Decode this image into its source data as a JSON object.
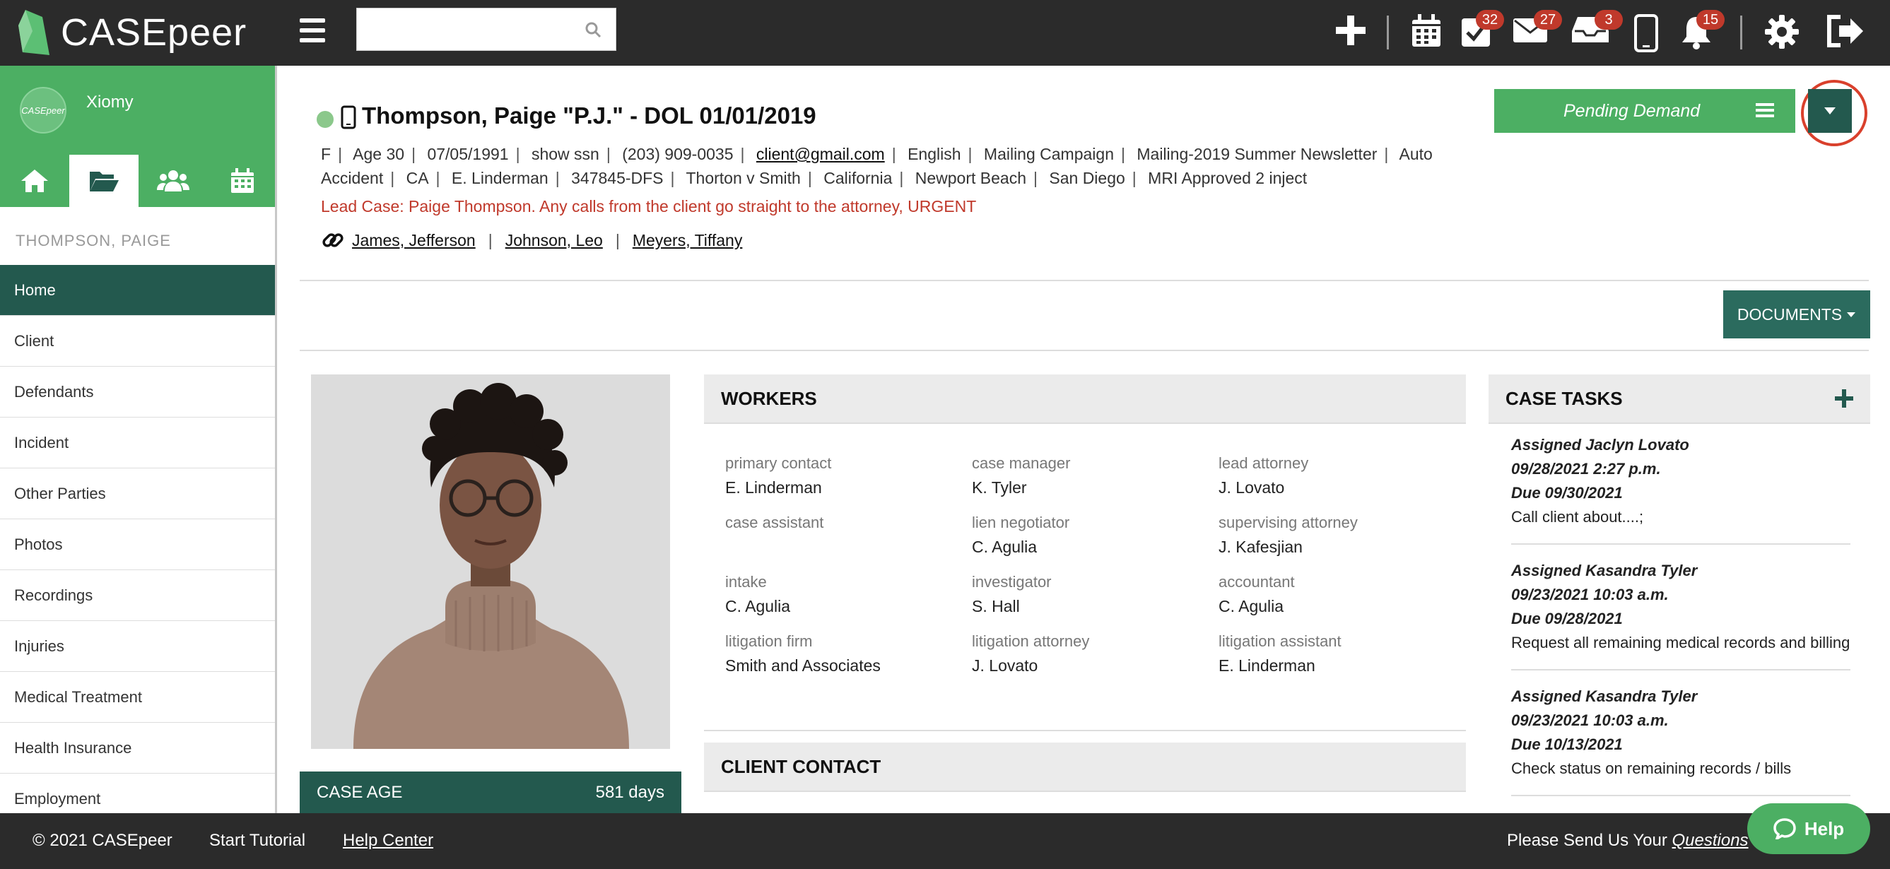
{
  "brand": {
    "name": "CASEpeer",
    "avatar_text": "CASEpeer"
  },
  "search": {
    "placeholder": ""
  },
  "topbar": {
    "badges": {
      "tasks": "32",
      "messages": "27",
      "inbox": "3",
      "notifications": "15"
    }
  },
  "sidebar": {
    "user_name": "Xiomy",
    "section_title": "THOMPSON, PAIGE",
    "items": [
      {
        "label": "Home",
        "active": true
      },
      {
        "label": "Client"
      },
      {
        "label": "Defendants"
      },
      {
        "label": "Incident"
      },
      {
        "label": "Other Parties"
      },
      {
        "label": "Photos"
      },
      {
        "label": "Recordings"
      },
      {
        "label": "Injuries"
      },
      {
        "label": "Medical Treatment"
      },
      {
        "label": "Health Insurance"
      },
      {
        "label": "Employment"
      }
    ]
  },
  "case": {
    "title": "Thompson, Paige \"P.J.\" - DOL 01/01/2019",
    "status_label": "Pending Demand",
    "meta": [
      "F",
      "Age 30",
      "07/05/1991",
      "show ssn",
      "(203) 909-0035",
      "client@gmail.com",
      "English",
      "Mailing Campaign",
      "Mailing-2019 Summer Newsletter",
      "Auto Accident",
      "CA",
      "E. Linderman",
      "347845-DFS",
      "Thorton v Smith",
      "California",
      "Newport Beach",
      "San Diego",
      "MRI Approved 2 inject"
    ],
    "lead_note": "Lead Case: Paige Thompson. Any calls from the client go straight to the attorney, URGENT",
    "related": [
      "James, Jefferson",
      "Johnson, Leo",
      "Meyers, Tiffany"
    ],
    "documents_label": "DOCUMENTS",
    "case_age_label": "CASE AGE",
    "case_age_value": "581 days"
  },
  "workers": {
    "title": "WORKERS",
    "items": [
      {
        "label": "primary contact",
        "value": "E. Linderman"
      },
      {
        "label": "case manager",
        "value": "K. Tyler"
      },
      {
        "label": "lead attorney",
        "value": "J. Lovato"
      },
      {
        "label": "case assistant",
        "value": ""
      },
      {
        "label": "lien negotiator",
        "value": "C. Agulia"
      },
      {
        "label": "supervising attorney",
        "value": "J. Kafesjian"
      },
      {
        "label": "intake",
        "value": "C. Agulia"
      },
      {
        "label": "investigator",
        "value": "S. Hall"
      },
      {
        "label": "accountant",
        "value": "C. Agulia"
      },
      {
        "label": "litigation firm",
        "value": "Smith and Associates"
      },
      {
        "label": "litigation attorney",
        "value": "J. Lovato"
      },
      {
        "label": "litigation assistant",
        "value": "E. Linderman"
      }
    ]
  },
  "client_contact": {
    "title": "CLIENT CONTACT"
  },
  "tasks": {
    "title": "CASE TASKS",
    "items": [
      {
        "assigned": "Assigned Jaclyn Lovato",
        "date": "09/28/2021 2:27 p.m.",
        "due": "Due 09/30/2021",
        "desc": "Call client about....;"
      },
      {
        "assigned": "Assigned Kasandra Tyler",
        "date": "09/23/2021 10:03 a.m.",
        "due": "Due 09/28/2021",
        "desc": "Request all remaining medical records and billing"
      },
      {
        "assigned": "Assigned Kasandra Tyler",
        "date": "09/23/2021 10:03 a.m.",
        "due": "Due 10/13/2021",
        "desc": "Check status on remaining records / bills"
      }
    ]
  },
  "footer": {
    "copyright": "© 2021 CASEpeer",
    "tutorial": "Start Tutorial",
    "help_center": "Help Center",
    "feedback_prefix": "Please Send Us Your ",
    "feedback_link": "Questions",
    "help_button": "Help"
  },
  "colors": {
    "brand_green": "#4caf63",
    "dark_teal": "#23594e",
    "alert_red": "#c0392b",
    "topbar": "#2b2b2b"
  }
}
